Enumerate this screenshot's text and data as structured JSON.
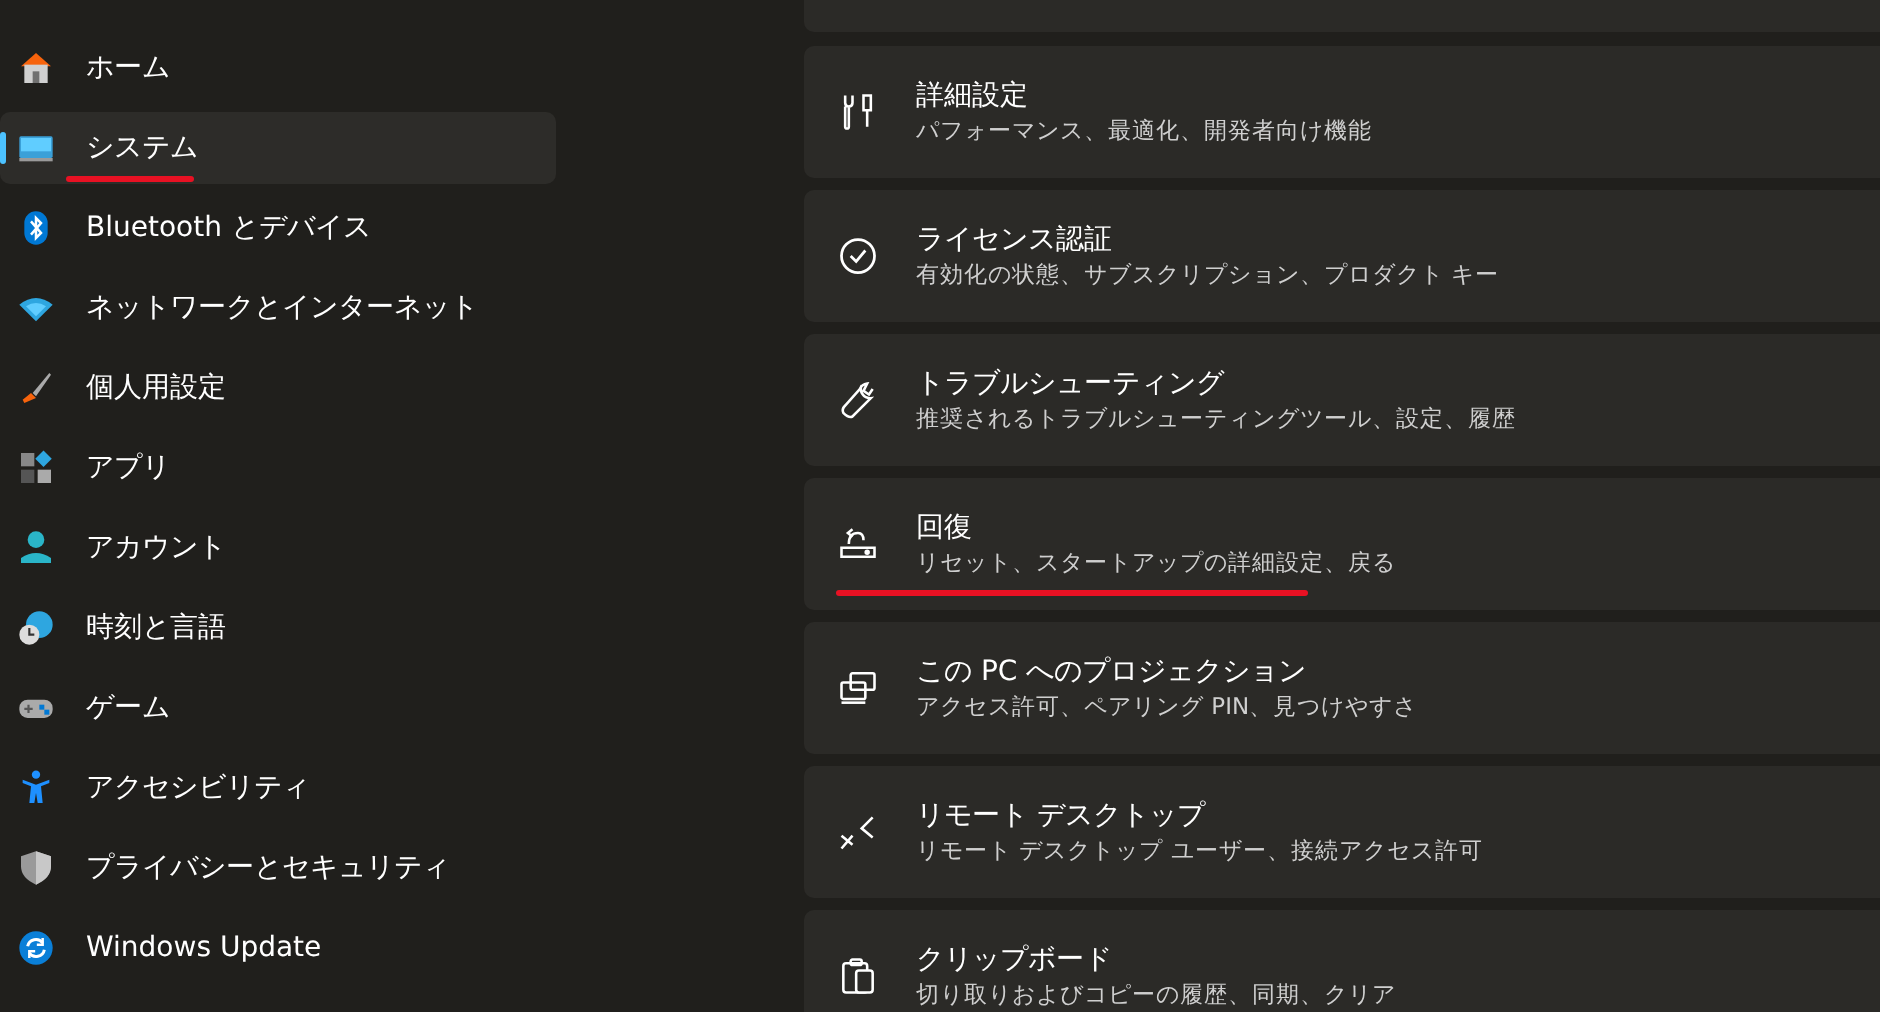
{
  "sidebar": {
    "items": [
      {
        "label": "ホーム",
        "kind": "home",
        "selected": false,
        "underlined": false
      },
      {
        "label": "システム",
        "kind": "system",
        "selected": true,
        "underlined": true
      },
      {
        "label": "Bluetooth とデバイス",
        "kind": "bluetooth",
        "selected": false,
        "underlined": false
      },
      {
        "label": "ネットワークとインターネット",
        "kind": "wifi",
        "selected": false,
        "underlined": false
      },
      {
        "label": "個人用設定",
        "kind": "brush",
        "selected": false,
        "underlined": false
      },
      {
        "label": "アプリ",
        "kind": "apps",
        "selected": false,
        "underlined": false
      },
      {
        "label": "アカウント",
        "kind": "person",
        "selected": false,
        "underlined": false
      },
      {
        "label": "時刻と言語",
        "kind": "globe",
        "selected": false,
        "underlined": false
      },
      {
        "label": "ゲーム",
        "kind": "gamepad",
        "selected": false,
        "underlined": false
      },
      {
        "label": "アクセシビリティ",
        "kind": "access",
        "selected": false,
        "underlined": false
      },
      {
        "label": "プライバシーとセキュリティ",
        "kind": "shield",
        "selected": false,
        "underlined": false
      },
      {
        "label": "Windows Update",
        "kind": "update",
        "selected": false,
        "underlined": false
      }
    ]
  },
  "settings": [
    {
      "title": "詳細設定",
      "subtitle": "パフォーマンス、最適化、開発者向け機能",
      "kind": "tools",
      "underlined": false
    },
    {
      "title": "ライセンス認証",
      "subtitle": "有効化の状態、サブスクリプション、プロダクト キー",
      "kind": "check",
      "underlined": false
    },
    {
      "title": "トラブルシューティング",
      "subtitle": "推奨されるトラブルシューティングツール、設定、履歴",
      "kind": "wrench",
      "underlined": false
    },
    {
      "title": "回復",
      "subtitle": "リセット、スタートアップの詳細設定、戻る",
      "kind": "recovery",
      "underlined": true
    },
    {
      "title": "この PC へのプロジェクション",
      "subtitle": "アクセス許可、ペアリング PIN、見つけやすさ",
      "kind": "project",
      "underlined": false
    },
    {
      "title": "リモート デスクトップ",
      "subtitle": "リモート デスクトップ ユーザー、接続アクセス許可",
      "kind": "remote",
      "underlined": false
    },
    {
      "title": "クリップボード",
      "subtitle": "切り取りおよびコピーの履歴、同期、クリア",
      "kind": "clipboard",
      "underlined": false
    }
  ]
}
